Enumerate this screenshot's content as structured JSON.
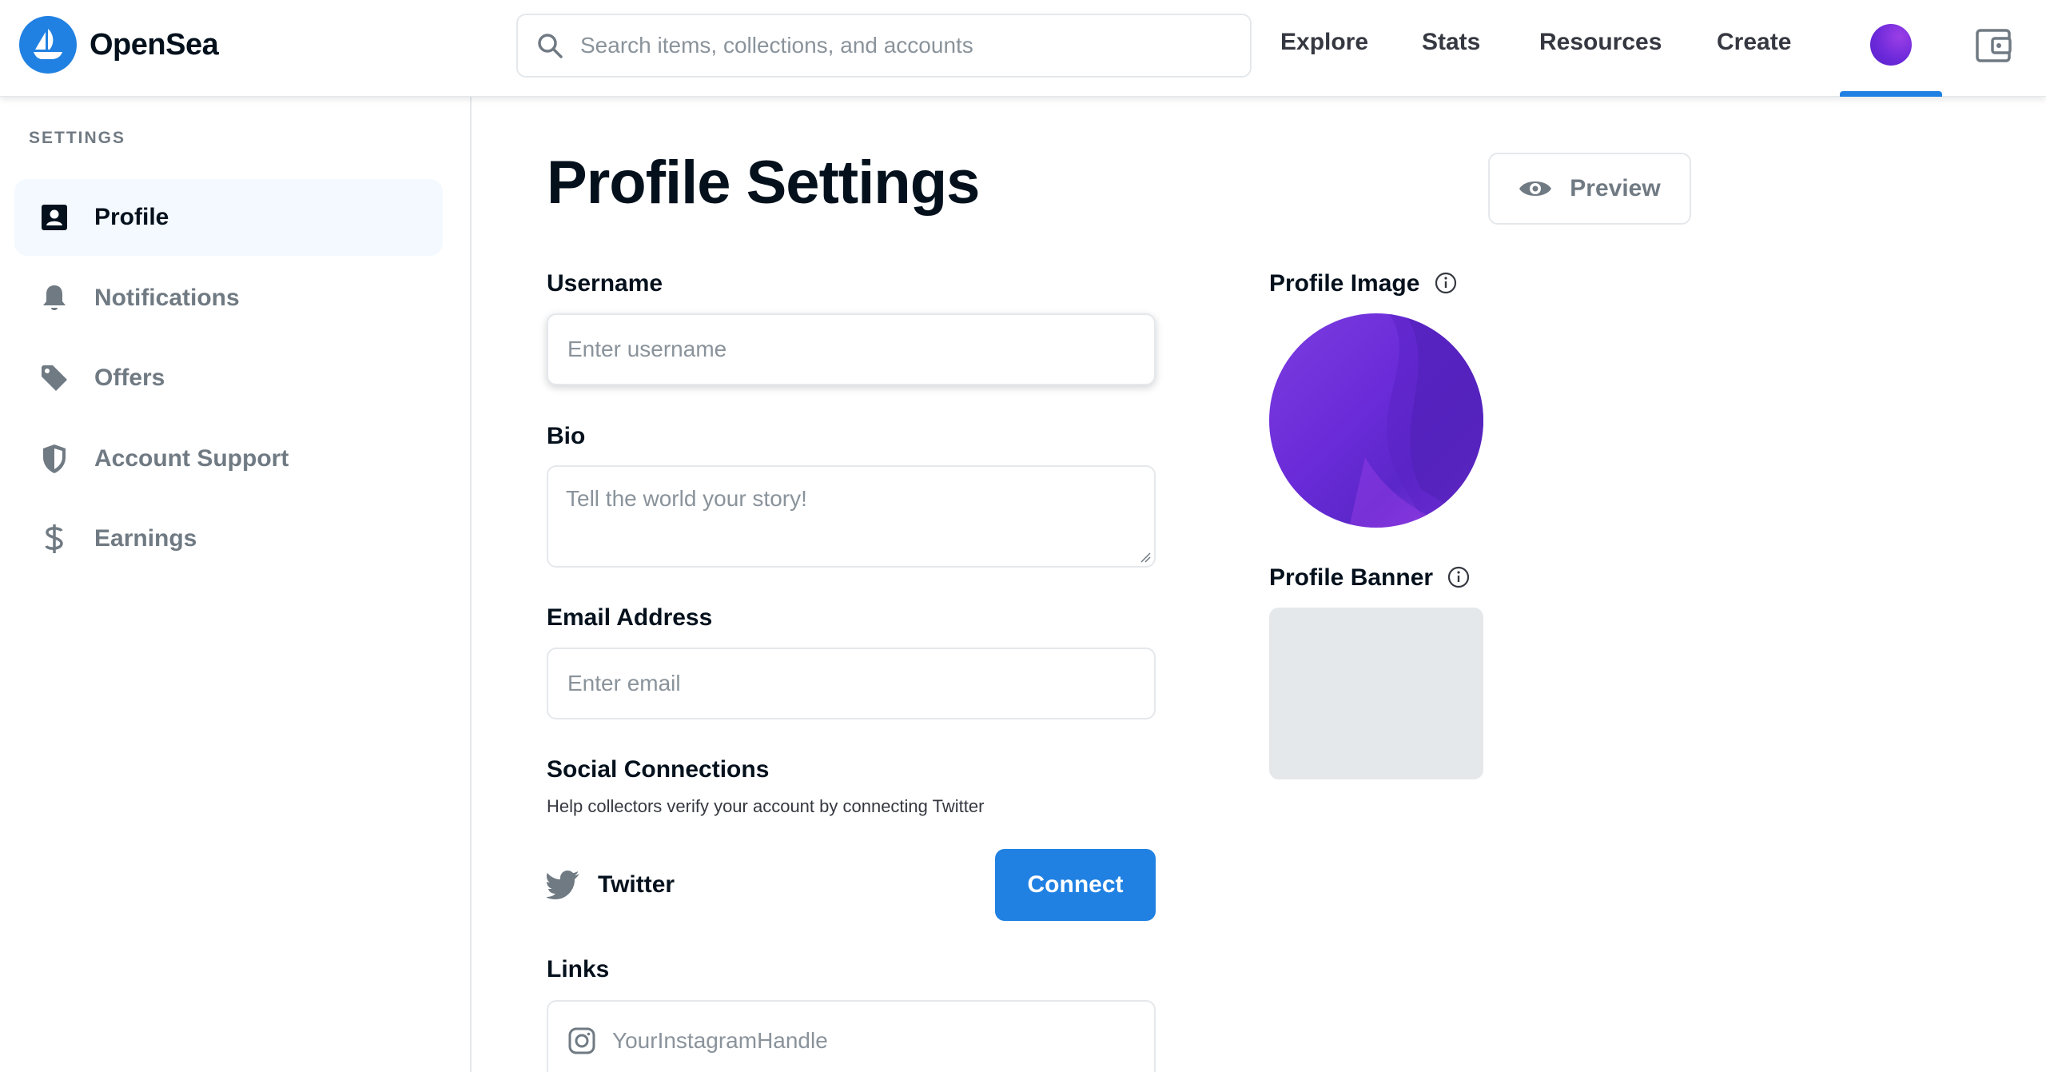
{
  "brand": {
    "name": "OpenSea",
    "color": "#2081e2"
  },
  "search": {
    "placeholder": "Search items, collections, and accounts"
  },
  "nav": {
    "explore": "Explore",
    "stats": "Stats",
    "resources": "Resources",
    "create": "Create"
  },
  "sidebar": {
    "title": "SETTINGS",
    "items": [
      {
        "label": "Profile",
        "icon": "profile-icon",
        "active": true
      },
      {
        "label": "Notifications",
        "icon": "bell-icon"
      },
      {
        "label": "Offers",
        "icon": "tag-icon"
      },
      {
        "label": "Account Support",
        "icon": "shield-icon"
      },
      {
        "label": "Earnings",
        "icon": "dollar-icon"
      }
    ]
  },
  "main": {
    "title": "Profile Settings",
    "preview_label": "Preview",
    "username": {
      "label": "Username",
      "placeholder": "Enter username",
      "value": ""
    },
    "bio": {
      "label": "Bio",
      "placeholder": "Tell the world your story!",
      "value": ""
    },
    "email": {
      "label": "Email Address",
      "placeholder": "Enter email",
      "value": ""
    },
    "social": {
      "label": "Social Connections",
      "help": "Help collectors verify your account by connecting Twitter",
      "twitter_label": "Twitter",
      "connect_label": "Connect"
    },
    "links": {
      "label": "Links",
      "placeholder": "YourInstagramHandle"
    },
    "profile_image_label": "Profile Image",
    "profile_banner_label": "Profile Banner"
  },
  "colors": {
    "accent": "#2081e2",
    "text": "#04111d",
    "muted": "#707a83",
    "avatar": "#6a28d9"
  }
}
